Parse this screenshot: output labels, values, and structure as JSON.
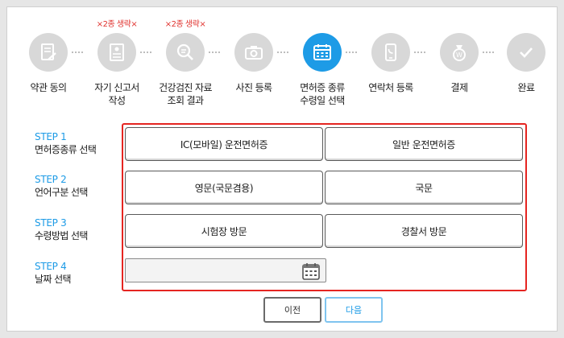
{
  "progress": {
    "steps": [
      {
        "label": "약관 동의",
        "icon": "document-edit-icon",
        "note": "",
        "active": false
      },
      {
        "label": "자기 신고서\n작성",
        "icon": "form-document-icon",
        "note": "×2종 생략×",
        "active": false
      },
      {
        "label": "건강검진 자료\n조회 결과",
        "icon": "magnifier-icon",
        "note": "×2종 생략×",
        "active": false
      },
      {
        "label": "사진 등록",
        "icon": "camera-icon",
        "note": "",
        "active": false
      },
      {
        "label": "면허증 종류\n수령일 선택",
        "icon": "calendar-icon",
        "note": "",
        "active": true
      },
      {
        "label": "연락처 등록",
        "icon": "phone-icon",
        "note": "",
        "active": false
      },
      {
        "label": "결제",
        "icon": "coin-bag-icon",
        "note": "",
        "active": false
      },
      {
        "label": "완료",
        "icon": "checkmark-icon",
        "note": "",
        "active": false
      }
    ]
  },
  "form": {
    "step1": {
      "num": "STEP 1",
      "title": "면허증종류 선택",
      "options": [
        "IC(모바일) 운전면허증",
        "일반 운전면허증"
      ]
    },
    "step2": {
      "num": "STEP 2",
      "title": "언어구분 선택",
      "options": [
        "영문(국문겸용)",
        "국문"
      ]
    },
    "step3": {
      "num": "STEP 3",
      "title": "수령방법 선택",
      "options": [
        "시험장 방문",
        "경찰서 방문"
      ]
    },
    "step4": {
      "num": "STEP 4",
      "title": "날짜 선택",
      "date_value": ""
    }
  },
  "buttons": {
    "prev": "이전",
    "next": "다음"
  },
  "colors": {
    "accent": "#1d9be6",
    "highlight": "#e52521",
    "note": "#e0332f",
    "inactive": "#d8d8d8"
  }
}
